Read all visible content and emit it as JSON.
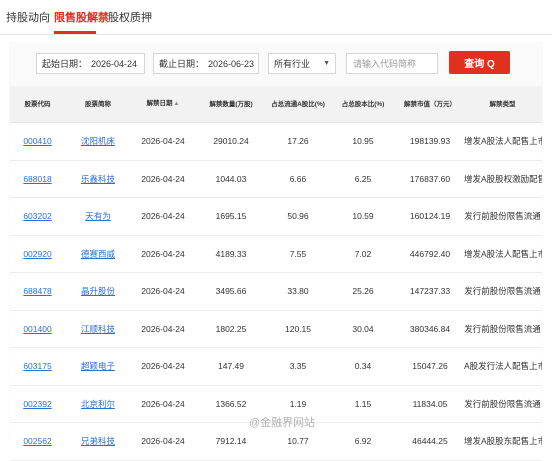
{
  "tabs": [
    {
      "label": "持股动向"
    },
    {
      "label": "限售股解禁"
    },
    {
      "label": "股权质押"
    }
  ],
  "filters": {
    "start_label": "起始日期：",
    "start_value": "2026-04-24",
    "end_label": "截止日期：",
    "end_value": "2026-06-23",
    "industry_value": "所有行业",
    "search_placeholder": "请输入代码简称",
    "query_label": "查询 Q"
  },
  "table": {
    "headers": [
      "股票代码",
      "股票简称",
      "解禁日期",
      "解禁数量(万股)",
      "占总流通A股比(%)",
      "占总股本比(%)",
      "解禁市值（万元）",
      "解禁类型"
    ],
    "rows": [
      {
        "code": "000410",
        "name": "沈阳机床",
        "date": "2026-04-24",
        "qty": "29010.24",
        "float_pct": "17.26",
        "total_pct": "10.95",
        "mv": "198139.93",
        "type": "增发A股法人配售上市"
      },
      {
        "code": "688018",
        "name": "乐鑫科技",
        "date": "2026-04-24",
        "qty": "1044.03",
        "float_pct": "6.66",
        "total_pct": "6.25",
        "mv": "176837.60",
        "type": "增发A股股权激励配售上市"
      },
      {
        "code": "603202",
        "name": "天有为",
        "date": "2026-04-24",
        "qty": "1695.15",
        "float_pct": "50.96",
        "total_pct": "10.59",
        "mv": "160124.19",
        "type": "发行前股份限售流通"
      },
      {
        "code": "002920",
        "name": "德赛西威",
        "date": "2026-04-24",
        "qty": "4189.33",
        "float_pct": "7.55",
        "total_pct": "7.02",
        "mv": "446792.40",
        "type": "增发A股法人配售上市"
      },
      {
        "code": "688478",
        "name": "晶升股份",
        "date": "2026-04-24",
        "qty": "3495.66",
        "float_pct": "33.80",
        "total_pct": "25.26",
        "mv": "147237.33",
        "type": "发行前股份限售流通"
      },
      {
        "code": "001400",
        "name": "江顺科技",
        "date": "2026-04-24",
        "qty": "1802.25",
        "float_pct": "120.15",
        "total_pct": "30.04",
        "mv": "380346.84",
        "type": "发行前股份限售流通"
      },
      {
        "code": "603175",
        "name": "超颖电子",
        "date": "2026-04-24",
        "qty": "147.49",
        "float_pct": "3.35",
        "total_pct": "0.34",
        "mv": "15047.26",
        "type": "A股发行法人配售上市"
      },
      {
        "code": "002392",
        "name": "北京利尔",
        "date": "2026-04-24",
        "qty": "1366.52",
        "float_pct": "1.19",
        "total_pct": "1.15",
        "mv": "11834.05",
        "type": "发行前股份限售流通"
      },
      {
        "code": "002562",
        "name": "兄弟科技",
        "date": "2026-04-24",
        "qty": "7912.14",
        "float_pct": "10.77",
        "total_pct": "6.92",
        "mv": "46444.25",
        "type": "增发A股股东配售上市"
      }
    ]
  },
  "watermark": "@金融界网站",
  "colors": {
    "accent": "#e0301e",
    "link": "#2a6fd6",
    "header_bg": "#f2f2f2"
  }
}
